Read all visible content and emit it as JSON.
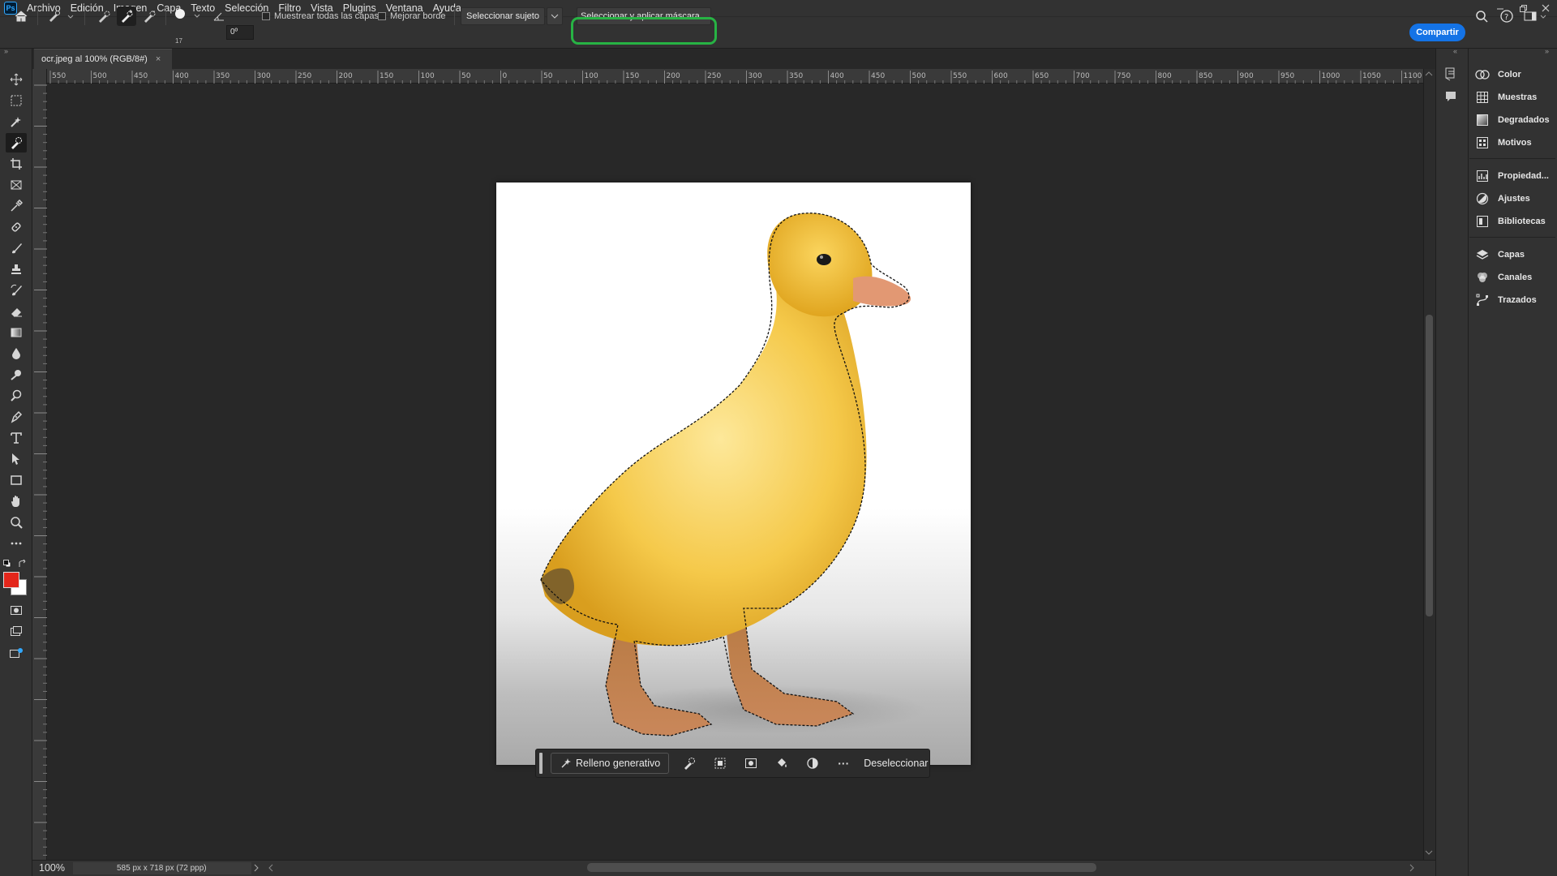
{
  "app": {
    "logo_text": "Ps"
  },
  "menu": [
    "Archivo",
    "Edición",
    "Imagen",
    "Capa",
    "Texto",
    "Selección",
    "Filtro",
    "Vista",
    "Plugins",
    "Ventana",
    "Ayuda"
  ],
  "options": {
    "brush_size": "17",
    "angle_value": "0º",
    "sample_all_layers": "Muestrear todas las capas",
    "enhance_edge": "Mejorar borde",
    "select_subject": "Seleccionar sujeto",
    "select_and_mask": "Seleccionar y aplicar máscara...",
    "share": "Compartir"
  },
  "document": {
    "tab_title": "ocr.jpeg al 100% (RGB/8#)",
    "close_glyph": "×",
    "zoom": "100%",
    "dimensions": "585 px x 718 px (72 ppp)"
  },
  "ruler": {
    "h_labels": [
      "550",
      "500",
      "450",
      "400",
      "350",
      "300",
      "250",
      "200",
      "150",
      "100",
      "50",
      "0",
      "50",
      "100",
      "150",
      "200",
      "250",
      "300",
      "350",
      "400",
      "450",
      "500",
      "550",
      "600",
      "650",
      "700",
      "750",
      "800",
      "850",
      "900",
      "950",
      "1000",
      "1050",
      "1100"
    ]
  },
  "taskbar": {
    "generative_fill": "Relleno generativo",
    "more": "···",
    "deselect": "Deseleccionar"
  },
  "panels": {
    "group1": [
      "Color",
      "Muestras",
      "Degradados",
      "Motivos"
    ],
    "group2": [
      "Propiedad...",
      "Ajustes",
      "Bibliotecas"
    ],
    "group3": [
      "Capas",
      "Canales",
      "Trazados"
    ]
  },
  "colors": {
    "foreground": "#e3261b",
    "background": "#ffffff",
    "accent": "#1473e6",
    "highlight": "#27b344"
  }
}
